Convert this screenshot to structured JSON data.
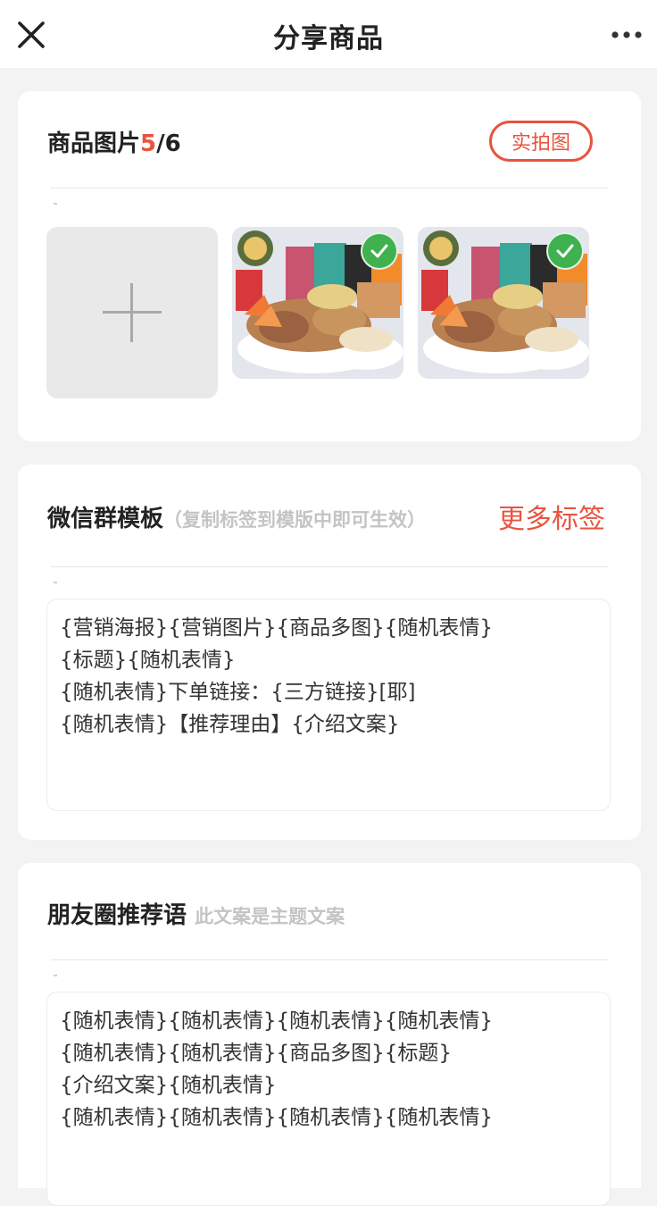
{
  "header": {
    "title": "分享商品",
    "close_icon": "close-icon",
    "more_icon": "more-dots-icon"
  },
  "images_section": {
    "title": "商品图片",
    "count_current": "5",
    "count_total": "/6",
    "real_shot_label": "实拍图",
    "add_icon": "plus-icon",
    "check_icon": "check-icon"
  },
  "wechat_group": {
    "title": "微信群模板",
    "hint": "（复制标签到模版中即可生效）",
    "more_tags_label": "更多标签",
    "lines": [
      "{营销海报}{营销图片}{商品多图}{随机表情}",
      "{标题}{随机表情}",
      "{随机表情}下单链接：{三方链接}[耶]",
      "{随机表情}【推荐理由】{介绍文案}"
    ]
  },
  "moments": {
    "title": "朋友圈推荐语",
    "hint": "此文案是主题文案",
    "lines": [
      "{随机表情}{随机表情}{随机表情}{随机表情}",
      "{随机表情}{随机表情}{商品多图}{标题}",
      "{介绍文案}{随机表情}",
      "{随机表情}{随机表情}{随机表情}{随机表情}"
    ]
  },
  "colors": {
    "accent": "#e8543f",
    "check_green": "#3fb14f",
    "background": "#f3f3f3"
  }
}
